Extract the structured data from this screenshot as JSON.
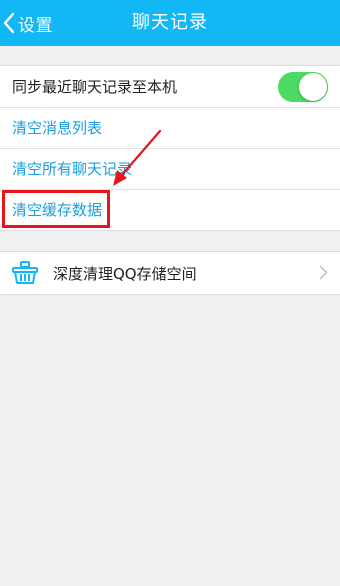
{
  "nav": {
    "back_label": "设置",
    "title": "聊天记录"
  },
  "settings": {
    "sync_label": "同步最近聊天记录至本机",
    "sync_enabled": true,
    "clear_message_list": "清空消息列表",
    "clear_all_chats": "清空所有聊天记录",
    "clear_cache": "清空缓存数据"
  },
  "storage": {
    "deep_clean_label": "深度清理QQ存储空间",
    "icon": "broom-basket-icon"
  },
  "colors": {
    "nav_bar": "#12b7f5",
    "action_text": "#1a9ee0",
    "toggle_on": "#4cd964",
    "annotation": "#e8141b"
  }
}
